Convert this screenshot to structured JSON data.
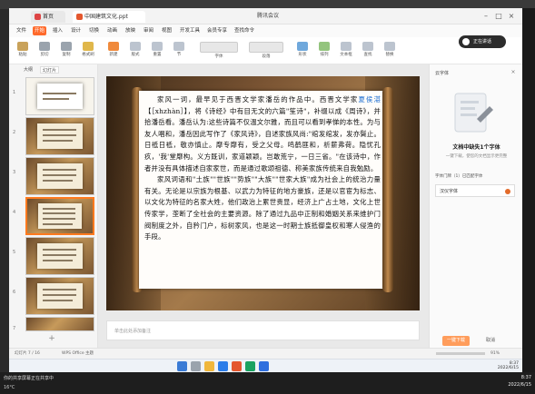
{
  "window": {
    "title": "腾讯会议",
    "tabs": [
      {
        "label": "首页"
      },
      {
        "label": "中国建筑文化.ppt"
      }
    ]
  },
  "menus": [
    "文件",
    "开始",
    "插入",
    "设计",
    "切换",
    "动画",
    "放映",
    "审阅",
    "视图",
    "开发工具",
    "会员专享",
    "查找命令"
  ],
  "active_menu": "开始",
  "ribbon": [
    "粘贴",
    "剪切",
    "复制",
    "格式刷",
    "新建",
    "版式",
    "重置",
    "节",
    "字体",
    "段落",
    "形状",
    "排列",
    "文本框",
    "查找",
    "替换"
  ],
  "left_panel": {
    "tabs": [
      "大纲",
      "幻灯片"
    ],
    "active_tab": "幻灯片",
    "slide_numbers": [
      "1",
      "2",
      "3",
      "4",
      "5",
      "6",
      "7"
    ],
    "add_label": "+"
  },
  "slide": {
    "para1_a": "家风一词，最早见于西晋文学家潘岳的作品中。西晋文学家",
    "para1_link": "夏侯湛",
    "para1_b": "【［xhzhàn］】，将《诗经》中有目无文的六篇\"笙诗\"，补缀以成《周诗》，并拾潘岳看。潘岳认为:这些诗篇不仅温文尔雅，而且可以看到孝悌的本性。为与友人唱和，潘岳因此写作了《家风诗》，自述家族风尚:\"绾发绾发，发亦鬓止。日祗日祗，敬亦慎止。靡专靡有，受之父母。鸣鹤匪和，析薪弗荷。隐忧孔疚，'我'堂靡构。义方既训，家道颖颖。岂敢荒宁，一日三省。\"在该诗中，作者并没有具体描述自家家世，而是通过歌颂祖德、称美家族传统来自我勉励。",
    "para2": "家风词语和\"土族\"\"世族\"\"势族\"\"大族\"\"世家大族\"成为社会上的统治力量有关。无论是以宗族为根基、以武力为特征的地方豪族，还是以官宦为标志、以文化为特征的名家大姓，他们政治上累世贵显，经济上广占土地，文化上世传家学，垄断了全社会的主要资源。除了通过九品中正制和婚姻关系来维护门阀制度之外，自矜门户，标树家风，也是这一时期士族抵御皇权和寒人侵渔的手段。"
  },
  "notes_placeholder": "单击此处添加备注",
  "right_panel": {
    "title": "云字体",
    "close": "×",
    "heading": "文档中缺失1个字体",
    "subheading": "一键下载，使您的文档显示更完整",
    "missing_label": "字体门牌（1）已匹配字体",
    "font_item": "汉仪字体",
    "ok_label": "一键下载",
    "cancel_label": "取消"
  },
  "statusbar": {
    "left": "幻灯片 7 / 16",
    "theme": "WPS Office 主题",
    "zoom": "91%"
  },
  "meeting": {
    "label": "正在讲话"
  },
  "taskbar": {
    "time": "8:37",
    "date": "2022/6/15"
  },
  "bottom": {
    "notice": "你的共享屏幕正在共享中",
    "weather": "16°C",
    "time": "8:37",
    "date": "2022/6/15"
  }
}
